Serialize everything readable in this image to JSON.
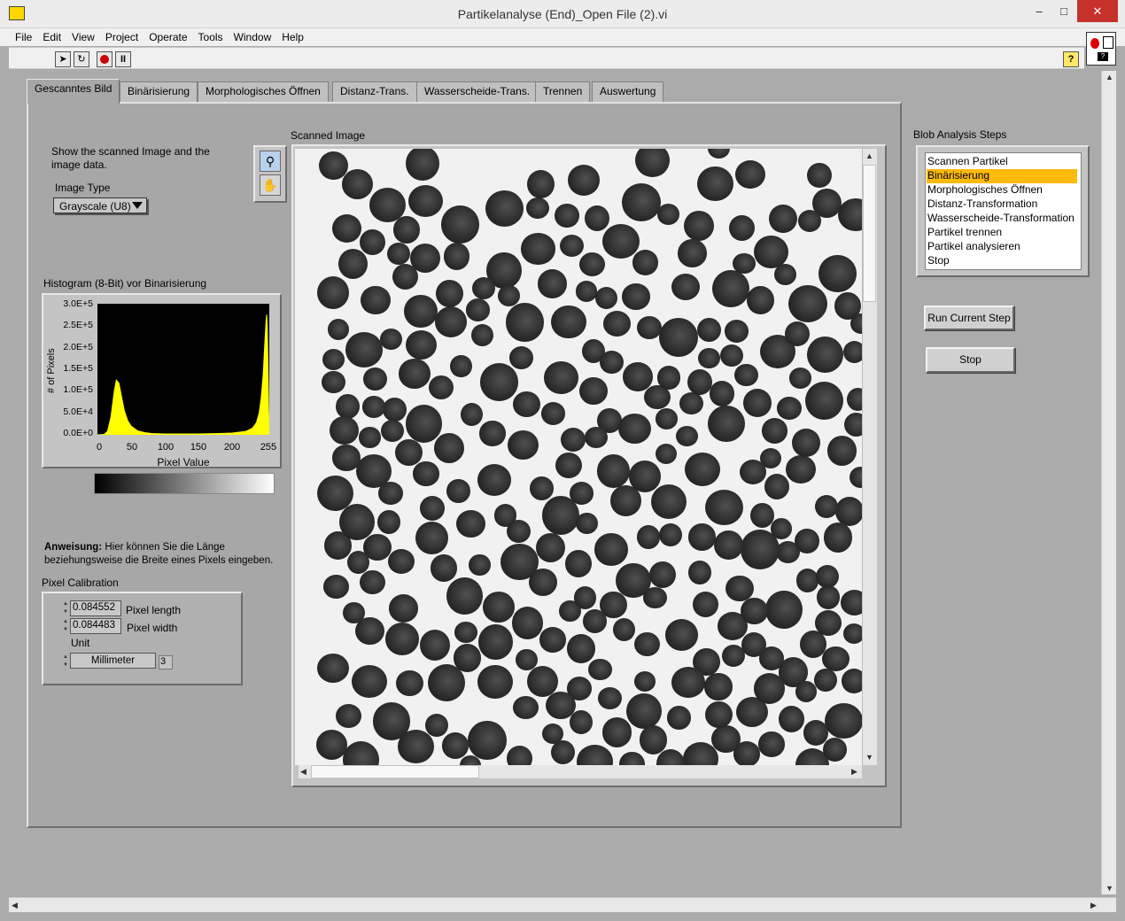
{
  "window": {
    "title": "Partikelanalyse (End)_Open File (2).vi",
    "minimize": "–",
    "maximize": "□",
    "close": "✕"
  },
  "menu": [
    "File",
    "Edit",
    "View",
    "Project",
    "Operate",
    "Tools",
    "Window",
    "Help"
  ],
  "toolbar": {
    "run": "run-arrow-icon",
    "run_continuous": "run-continuously-icon",
    "abort": "abort-icon",
    "pause": "pause-icon",
    "help": "?"
  },
  "tabs": [
    "Gescanntes Bild",
    "Binärisierung",
    "Morphologisches Öffnen",
    "Distanz-Trans.",
    "Wasserscheide-Trans.",
    "Trennen",
    "Auswertung"
  ],
  "active_tab": 0,
  "left": {
    "description_line1": "Show the scanned Image and the",
    "description_line2": "image data.",
    "image_type_label": "Image Type",
    "image_type_value": "Grayscale (U8)"
  },
  "histogram": {
    "title": "Histogram (8-Bit) vor Binarisierung",
    "ylabel": "# of Pixels",
    "xlabel": "Pixel Value",
    "yticks": [
      "3.0E+5",
      "2.5E+5",
      "2.0E+5",
      "1.5E+5",
      "1.0E+5",
      "5.0E+4",
      "0.0E+0"
    ],
    "xticks": [
      "0",
      "50",
      "100",
      "150",
      "200",
      "255"
    ],
    "series_color": "#ffff00",
    "bg_color": "#000000"
  },
  "chart_data": {
    "type": "area",
    "title": "Histogram (8-Bit) vor Binarisierung",
    "xlabel": "Pixel Value",
    "ylabel": "# of Pixels",
    "xlim": [
      0,
      255
    ],
    "ylim": [
      0,
      300000
    ],
    "x": [
      0,
      10,
      15,
      20,
      25,
      28,
      32,
      36,
      40,
      45,
      50,
      60,
      70,
      80,
      100,
      120,
      150,
      180,
      200,
      220,
      230,
      236,
      240,
      243,
      246,
      248,
      250,
      251,
      252,
      253,
      254,
      255
    ],
    "values": [
      0,
      1000,
      8000,
      40000,
      100000,
      125000,
      118000,
      85000,
      55000,
      32000,
      20000,
      9000,
      5000,
      3000,
      2000,
      2000,
      2000,
      3000,
      4000,
      8000,
      15000,
      28000,
      50000,
      85000,
      140000,
      200000,
      255000,
      275000,
      250000,
      160000,
      60000,
      0
    ]
  },
  "instruction": {
    "bold": "Anweisung:",
    "text_line1": " Hier können Sie die Länge",
    "text_line2": "beziehungsweise die Breite eines Pixels eingeben."
  },
  "calibration": {
    "title": "Pixel Calibration",
    "pixel_length_value": "0.084552",
    "pixel_length_label": "Pixel length",
    "pixel_width_value": "0.084483",
    "pixel_width_label": "Pixel width",
    "unit_label": "Unit",
    "unit_value": "Millimeter",
    "unit_index": "3"
  },
  "image_display": {
    "label": "Scanned Image"
  },
  "steps": {
    "label": "Blob Analysis Steps",
    "items": [
      "Scannen Partikel",
      "Binärisierung",
      "Morphologisches Öffnen",
      "Distanz-Transformation",
      "Wasserscheide-Transformation",
      "Partikel trennen",
      "Partikel analysieren",
      "Stop"
    ],
    "selected_index": 1,
    "highlight_color": "#ffba0d"
  },
  "buttons": {
    "run_step": "Run Current Step",
    "stop": "Stop"
  }
}
